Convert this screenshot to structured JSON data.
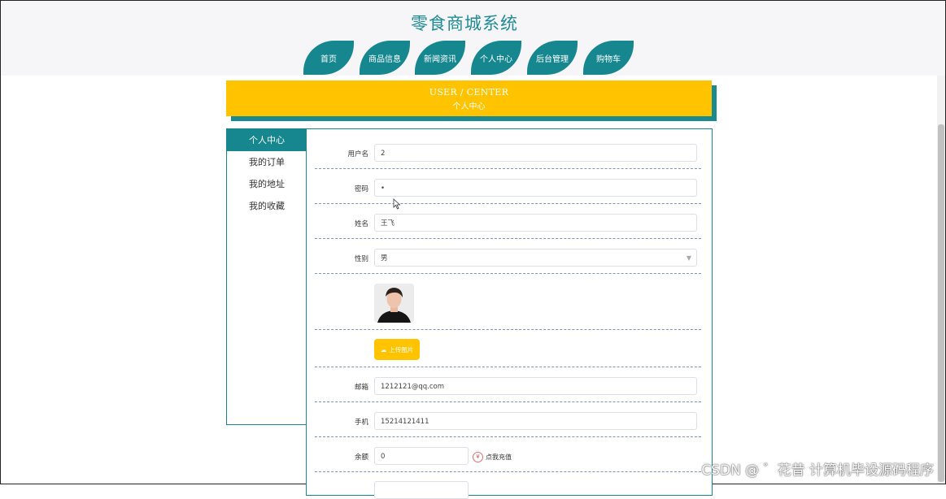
{
  "site": {
    "title": "零食商城系统"
  },
  "nav": {
    "items": [
      {
        "label": "首页"
      },
      {
        "label": "商品信息"
      },
      {
        "label": "新闻资讯"
      },
      {
        "label": "个人中心"
      },
      {
        "label": "后台管理"
      },
      {
        "label": "购物车"
      }
    ]
  },
  "banner": {
    "en": "USER / CENTER",
    "cn": "个人中心"
  },
  "sidebar": {
    "items": [
      {
        "label": "个人中心",
        "active": true
      },
      {
        "label": "我的订单"
      },
      {
        "label": "我的地址"
      },
      {
        "label": "我的收藏"
      }
    ]
  },
  "form": {
    "username_label": "用户名",
    "username_value": "2",
    "password_label": "密码",
    "password_value": "•",
    "name_label": "姓名",
    "name_value": "王飞",
    "gender_label": "性别",
    "gender_value": "男",
    "upload_label": "上传图片",
    "email_label": "邮箱",
    "email_value": "1212121@qq.com",
    "phone_label": "手机",
    "phone_value": "15214121411",
    "balance_label": "余额",
    "balance_value": "0",
    "recharge_label": "点我充值"
  },
  "watermark": "CSDN @ ゛花昔  计算机毕设源码程序",
  "colors": {
    "teal": "#16868f",
    "yellow": "#ffc300"
  }
}
